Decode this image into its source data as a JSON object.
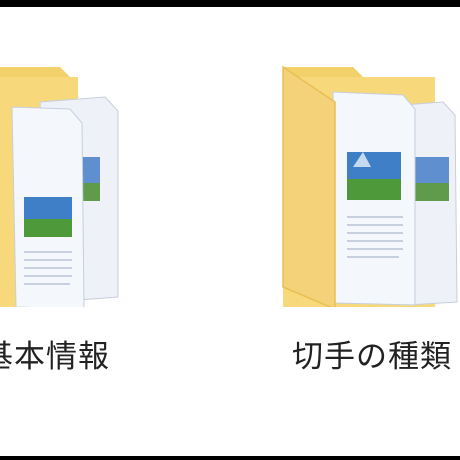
{
  "folders": [
    {
      "name": "基本情報",
      "icon": "folder-with-documents-icon"
    },
    {
      "name": "切手の種類",
      "icon": "folder-with-documents-icon"
    }
  ],
  "colors": {
    "frame": "#000000",
    "background": "#ffffff",
    "folder": "#f7d97b",
    "folder_dark": "#e8bf52",
    "paper": "#f4f7fb",
    "photo_blue": "#3f7fc8",
    "photo_green": "#4e9a3a",
    "label_text": "#222222"
  }
}
